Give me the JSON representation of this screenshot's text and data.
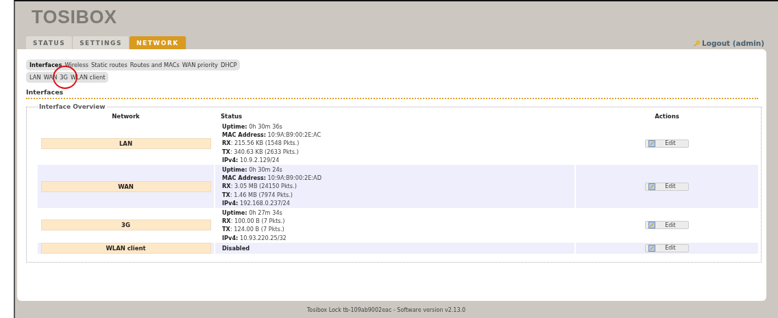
{
  "logo": "TOSIBOX",
  "tabs": [
    {
      "label": "STATUS",
      "selected": false
    },
    {
      "label": "SETTINGS",
      "selected": false
    },
    {
      "label": "NETWORK",
      "selected": true
    }
  ],
  "logout": "Logout (admin)",
  "subnav": [
    {
      "label": "Interfaces",
      "selected": true
    },
    {
      "label": "Wireless",
      "selected": false
    },
    {
      "label": "Static routes",
      "selected": false
    },
    {
      "label": "Routes and MACs",
      "selected": false
    },
    {
      "label": "WAN priority",
      "selected": false
    },
    {
      "label": "DHCP",
      "selected": false
    }
  ],
  "subnav2": [
    {
      "label": "LAN",
      "selected": false,
      "circled": false
    },
    {
      "label": "WAN",
      "selected": false,
      "circled": false
    },
    {
      "label": "3G",
      "selected": false,
      "circled": true
    },
    {
      "label": "WLAN client",
      "selected": false,
      "circled": false
    }
  ],
  "section_title": "Interfaces",
  "fieldset_title": "Interface Overview",
  "columns": [
    "Network",
    "Status",
    "Actions"
  ],
  "rows": [
    {
      "network": "LAN",
      "status": [
        "**Uptime:** 0h 30m 36s",
        "**MAC Address:** 10:9A:B9:00:2E:AC",
        "**RX**: 215.56 KB (1548 Pkts.)",
        "**TX**: 340.63 KB (2633 Pkts.)",
        "**IPv4:** 10.9.2.129/24"
      ],
      "action": "Edit"
    },
    {
      "network": "WAN",
      "status": [
        "**Uptime:** 0h 30m 24s",
        "**MAC Address:** 10:9A:B9:00:2E:AD",
        "**RX**: 3.05 MB (24150 Pkts.)",
        "**TX**: 1.46 MB (7974 Pkts.)",
        "**IPv4:** 192.168.0.237/24"
      ],
      "action": "Edit"
    },
    {
      "network": "3G",
      "status": [
        "**Uptime:** 0h 27m 34s",
        "**RX**: 100.00 B (7 Pkts.)",
        "**TX**: 124.00 B (7 Pkts.)",
        "**IPv4:** 10.93.220.25/32"
      ],
      "action": "Edit"
    },
    {
      "network": "WLAN client",
      "status": [
        "**Disabled**"
      ],
      "action": "Edit"
    }
  ],
  "footer": "Tosibox Lock tb-109ab9002eac - Software version v2.13.0"
}
